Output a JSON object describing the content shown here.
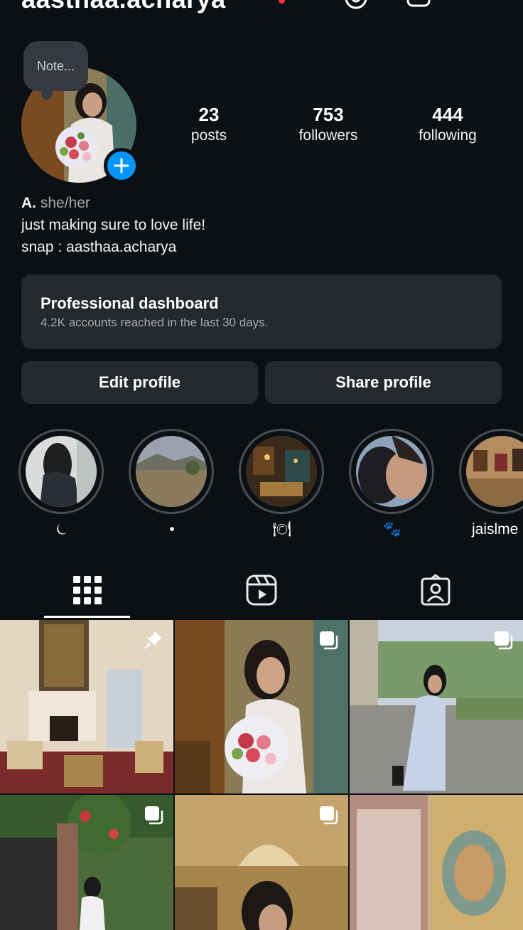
{
  "profile": {
    "username": "aasthaa.acharya",
    "note_placeholder": "Note...",
    "stats": [
      {
        "count": "23",
        "label": "posts"
      },
      {
        "count": "753",
        "label": "followers"
      },
      {
        "count": "444",
        "label": "following"
      }
    ],
    "bio": {
      "name": "A.",
      "pronouns": "she/her",
      "line1": "just making sure to love life!",
      "line2": "snap : aasthaa.acharya"
    }
  },
  "dashboard": {
    "title": "Professional dashboard",
    "subtitle": "4.2K accounts reached in the last 30 days."
  },
  "buttons": {
    "edit": "Edit profile",
    "share": "Share profile"
  },
  "highlights": [
    {
      "label": "⏾",
      "icon": "moon-icon"
    },
    {
      "label": "•",
      "icon": "dot"
    },
    {
      "label": "🍽",
      "icon": "plate-icon"
    },
    {
      "label": "🐾",
      "icon": "paw-icon"
    },
    {
      "label": "jaislme",
      "icon": ""
    }
  ],
  "tabs": [
    "grid-icon",
    "reels-icon",
    "tagged-icon"
  ],
  "colors": {
    "background": "#0b1014",
    "surface": "#25292e",
    "accent_blue": "#0095f6",
    "live_red": "#ff3040"
  }
}
